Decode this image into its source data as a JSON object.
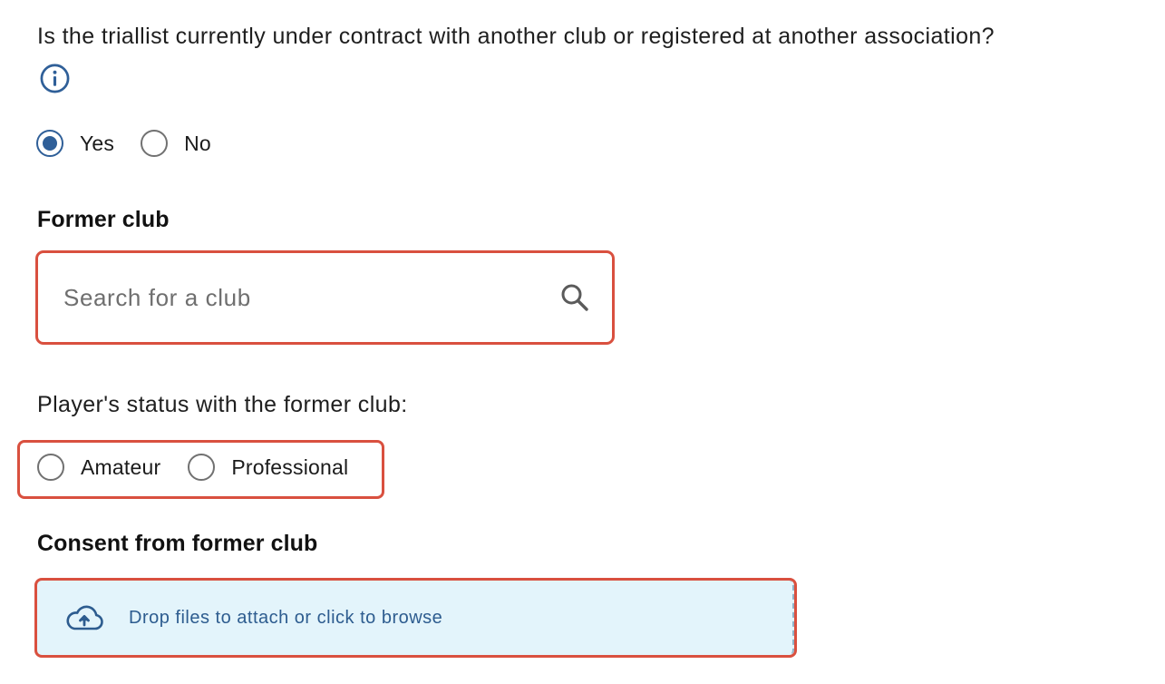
{
  "question": {
    "text": "Is the triallist currently under contract with another club or registered at another association?",
    "info_icon": "info-icon"
  },
  "contract_options": [
    {
      "label": "Yes",
      "checked": true
    },
    {
      "label": "No",
      "checked": false
    }
  ],
  "former_club": {
    "title": "Former club",
    "search_placeholder": "Search for a club",
    "search_value": "",
    "icon": "search-icon"
  },
  "player_status": {
    "label": "Player's status with the former club:",
    "options": [
      {
        "label": "Amateur",
        "checked": false
      },
      {
        "label": "Professional",
        "checked": false
      }
    ]
  },
  "consent": {
    "title": "Consent from former club",
    "upload_text": "Drop files to attach or click to browse",
    "icon": "cloud-upload-icon"
  },
  "colors": {
    "accent": "#2f5f98",
    "error_border": "#d9503f",
    "upload_background": "#e3f4fb",
    "upload_text": "#2d5c8f"
  }
}
